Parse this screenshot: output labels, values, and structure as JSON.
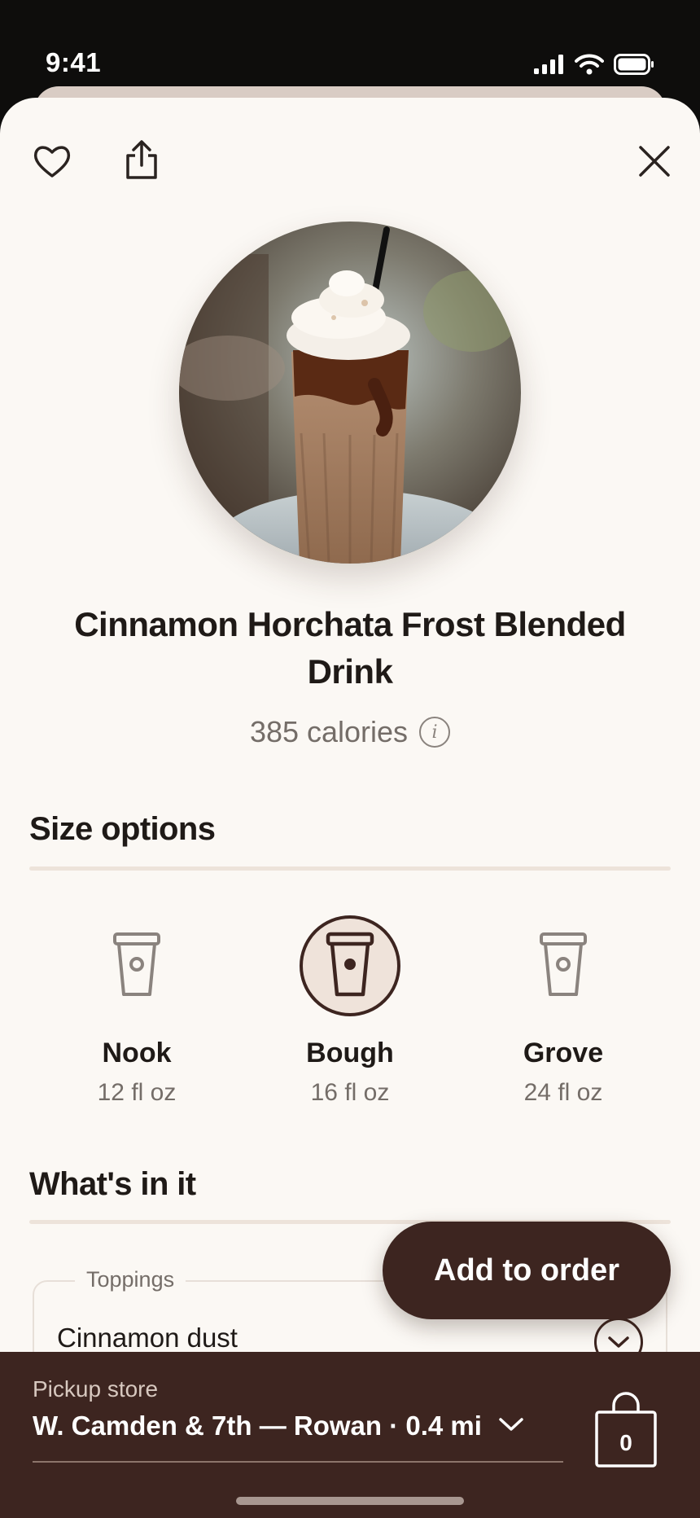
{
  "status_bar": {
    "time": "9:41",
    "icons": [
      "signal-icon",
      "wifi-icon",
      "battery-icon"
    ]
  },
  "header": {
    "icons": [
      "heart-icon",
      "share-icon",
      "close-icon"
    ]
  },
  "product": {
    "name": "Cinnamon Horchata Frost Blended Drink",
    "calories": "385 calories",
    "info_icon_glyph": "i"
  },
  "size_section": {
    "heading": "Size options",
    "options": [
      {
        "name": "Nook",
        "volume": "12 fl oz",
        "selected": false
      },
      {
        "name": "Bough",
        "volume": "16 fl oz",
        "selected": true
      },
      {
        "name": "Grove",
        "volume": "24 fl oz",
        "selected": false
      }
    ]
  },
  "whats_in_it": {
    "heading": "What's in it",
    "toppings_label": "Toppings",
    "topping_value": "Cinnamon dust"
  },
  "add_button": {
    "label": "Add to order"
  },
  "bottom_bar": {
    "pickup_label": "Pickup store",
    "store": "W. Camden & 7th — Rowan · 0.4 mi",
    "bag_count": "0"
  },
  "colors": {
    "accent": "#3d2520",
    "background": "#fbf8f4",
    "muted_text": "#746d68",
    "divider": "#ede3da"
  }
}
